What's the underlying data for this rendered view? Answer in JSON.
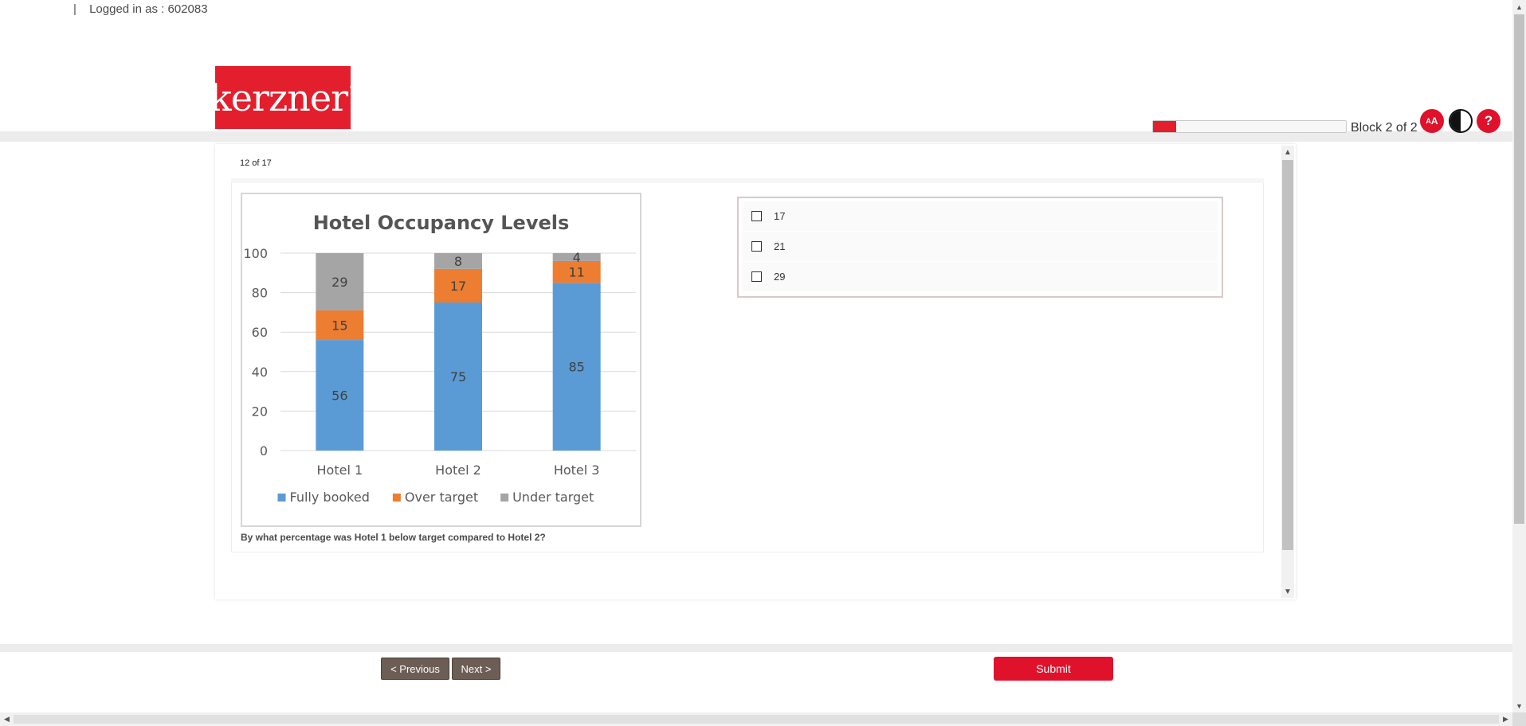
{
  "header": {
    "separator": "|",
    "logged_in": "Logged in as : 602083",
    "logo_text": "kerzner",
    "logo_mark": "®",
    "block_label": "Block 2 of 2",
    "progress": 0.12,
    "font_tool_small": "A",
    "font_tool_large": "A",
    "help_label": "?"
  },
  "question": {
    "counter": "12  of 17",
    "text": "By what percentage was Hotel 1 below target compared to Hotel 2?",
    "options": [
      "17",
      "21",
      "29"
    ]
  },
  "chart_data": {
    "type": "bar",
    "stacked": true,
    "title": "Hotel Occupancy Levels",
    "categories": [
      "Hotel 1",
      "Hotel 2",
      "Hotel 3"
    ],
    "series": [
      {
        "name": "Fully booked",
        "values": [
          56,
          75,
          85
        ],
        "color": "#5b9bd5"
      },
      {
        "name": "Over target",
        "values": [
          15,
          17,
          11
        ],
        "color": "#ed7d31"
      },
      {
        "name": "Under target",
        "values": [
          29,
          8,
          4
        ],
        "color": "#a5a5a5"
      }
    ],
    "yticks": [
      "0",
      "20",
      "40",
      "60",
      "80",
      "100"
    ],
    "ylim": [
      0,
      100
    ],
    "grid": true,
    "legend": "bottom"
  },
  "nav": {
    "previous": "< Previous",
    "next": "Next >",
    "submit": "Submit"
  },
  "colors": {
    "brand": "#e41f2d",
    "nav_button": "#6c5e55",
    "submit": "#e0112b"
  }
}
